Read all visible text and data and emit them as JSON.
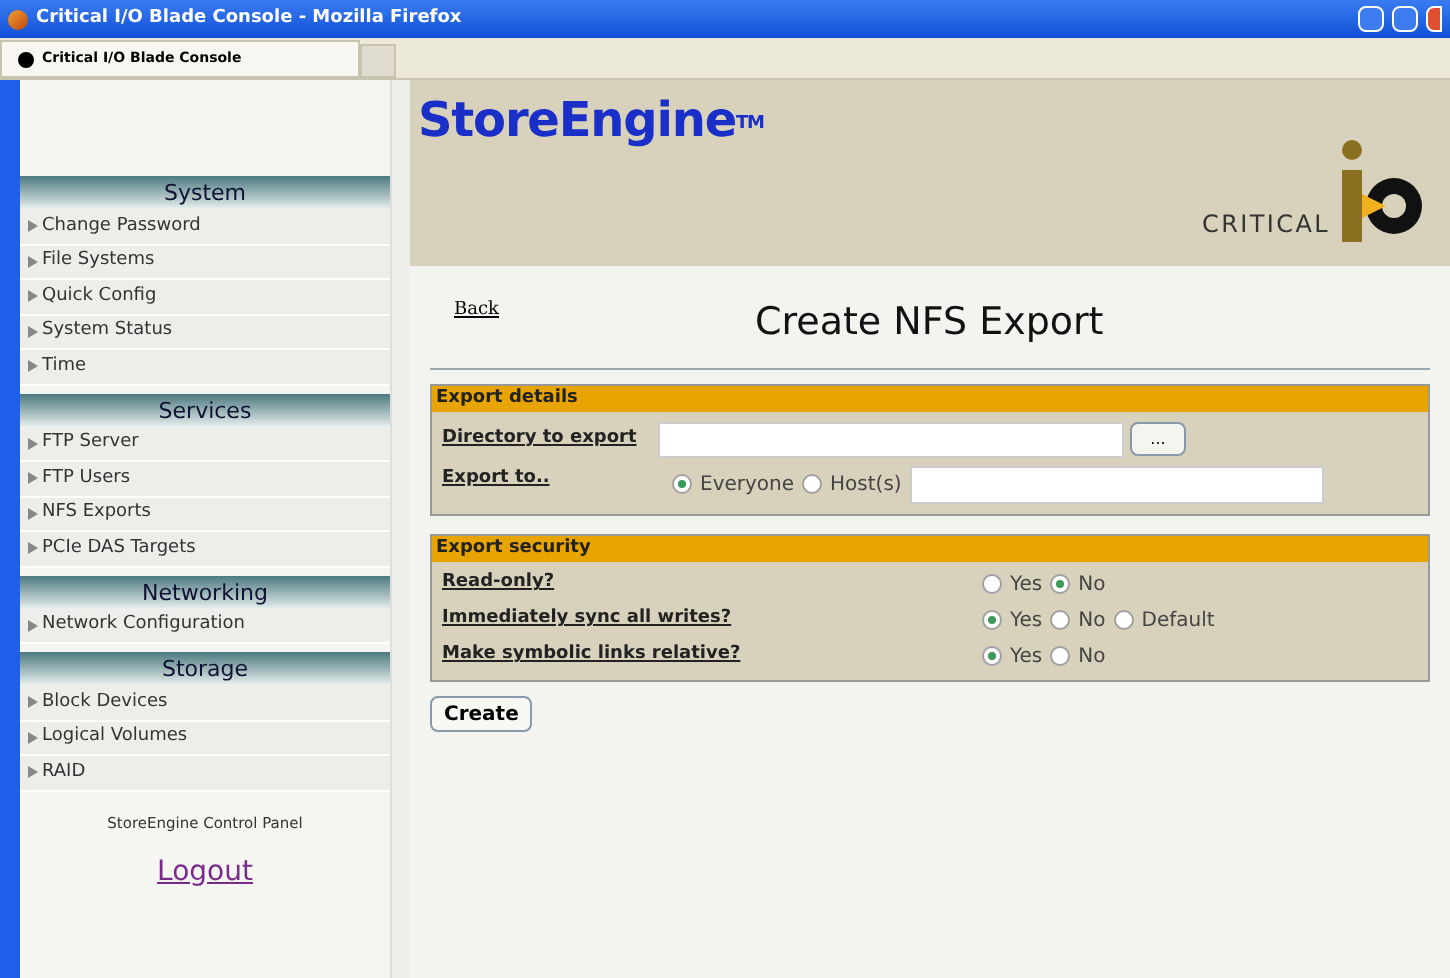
{
  "window": {
    "title": "Critical I/O Blade Console - Mozilla Firefox"
  },
  "tabs": [
    {
      "label": "Critical I/O Blade Console",
      "selected": true
    }
  ],
  "sidebar": {
    "sections": [
      {
        "title": "System",
        "items": [
          "Change Password",
          "File Systems",
          "Quick Config",
          "System Status",
          "Time"
        ]
      },
      {
        "title": "Services",
        "items": [
          "FTP Server",
          "FTP Users",
          "NFS Exports",
          "PCIe DAS Targets"
        ]
      },
      {
        "title": "Networking",
        "items": [
          "Network Configuration"
        ]
      },
      {
        "title": "Storage",
        "items": [
          "Block Devices",
          "Logical Volumes",
          "RAID"
        ]
      }
    ],
    "footer": "StoreEngine Control Panel",
    "logout": "Logout"
  },
  "banner": {
    "product": "StoreEngine",
    "trademark": "TM",
    "company": "CRITICAL"
  },
  "back_link": "Back",
  "page_title": "Create NFS Export",
  "export_details": {
    "title": "Export details",
    "directory_label": "Directory to export",
    "browse_button": "...",
    "export_to_label": "Export to..",
    "options": [
      {
        "label": "Everyone",
        "selected": true
      },
      {
        "label": "Host(s)",
        "selected": false
      }
    ]
  },
  "export_security": {
    "title": "Export security",
    "rows": [
      {
        "label": "Read-only?",
        "options": [
          {
            "label": "Yes",
            "selected": false
          },
          {
            "label": "No",
            "selected": true
          }
        ]
      },
      {
        "label": "Immediately sync all writes?",
        "options": [
          {
            "label": "Yes",
            "selected": true
          },
          {
            "label": "No",
            "selected": false
          },
          {
            "label": "Default",
            "selected": false
          }
        ]
      },
      {
        "label": "Make symbolic links relative?",
        "options": [
          {
            "label": "Yes",
            "selected": true
          },
          {
            "label": "No",
            "selected": false
          }
        ]
      }
    ]
  },
  "create_button": "Create"
}
